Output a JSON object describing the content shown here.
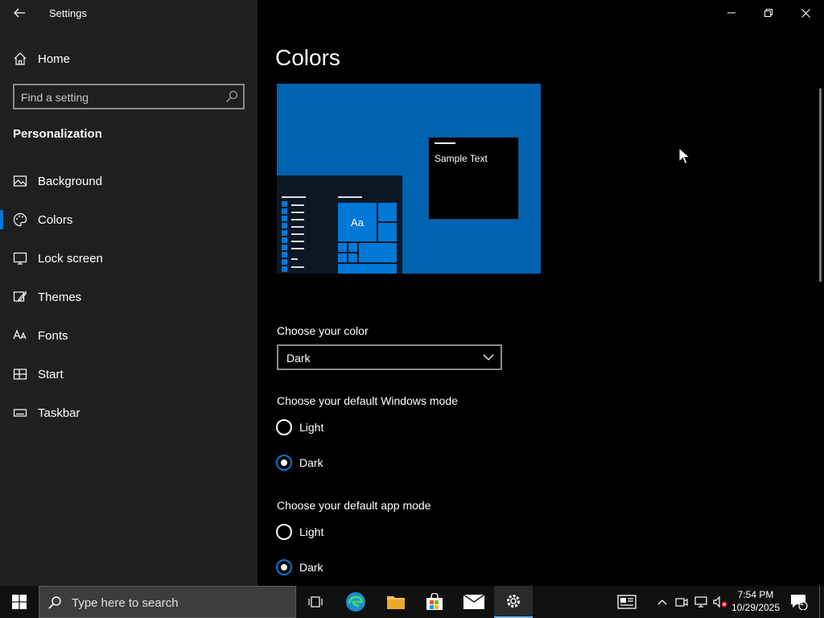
{
  "window": {
    "title": "Settings"
  },
  "sidebar": {
    "home_label": "Home",
    "search_placeholder": "Find a setting",
    "section_title": "Personalization",
    "items": [
      {
        "label": "Background",
        "icon": "picture-icon"
      },
      {
        "label": "Colors",
        "icon": "palette-icon",
        "active": true
      },
      {
        "label": "Lock screen",
        "icon": "lock-screen-icon"
      },
      {
        "label": "Themes",
        "icon": "brush-icon"
      },
      {
        "label": "Fonts",
        "icon": "font-icon"
      },
      {
        "label": "Start",
        "icon": "start-icon"
      },
      {
        "label": "Taskbar",
        "icon": "taskbar-icon"
      }
    ]
  },
  "main": {
    "page_title": "Colors",
    "preview": {
      "sample_text": "Sample Text",
      "tile_text": "Aa"
    },
    "choose_color": {
      "label": "Choose your color",
      "selected": "Dark"
    },
    "windows_mode": {
      "label": "Choose your default Windows mode",
      "options": [
        "Light",
        "Dark"
      ],
      "selected": "Dark"
    },
    "app_mode": {
      "label": "Choose your default app mode",
      "options": [
        "Light",
        "Dark"
      ],
      "selected": "Dark"
    }
  },
  "taskbar": {
    "search_placeholder": "Type here to search",
    "time": "7:54 PM",
    "date": "10/29/2025",
    "notification_count": "1"
  },
  "colors": {
    "accent": "#0078d7",
    "sidebar_bg": "#1f1f1f",
    "main_bg": "#000000",
    "preview_bg": "#0063b1"
  }
}
